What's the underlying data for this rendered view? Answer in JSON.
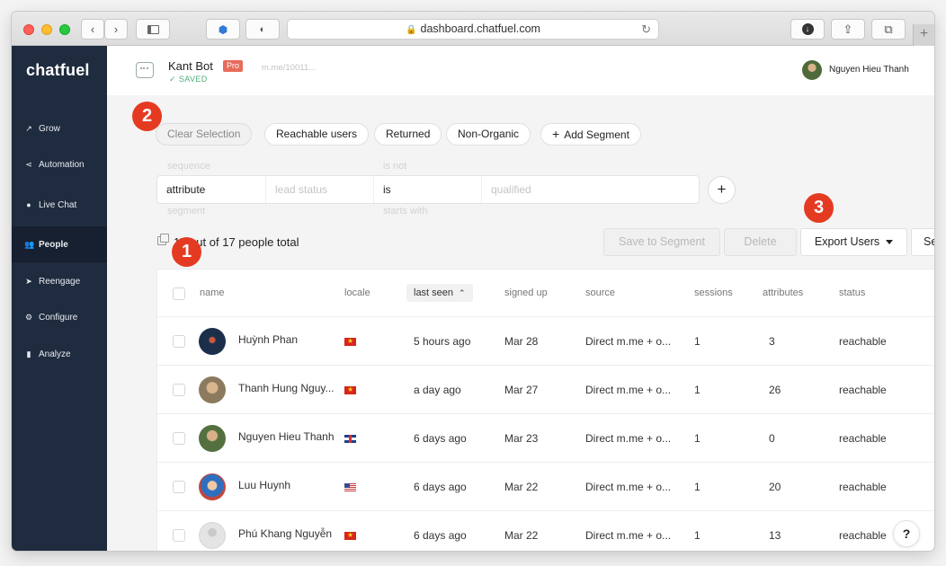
{
  "browser": {
    "url": "dashboard.chatfuel.com",
    "plus_tab": "+"
  },
  "sidebar": {
    "logo": "chatfuel",
    "items": [
      {
        "label": "Grow",
        "icon": "trend-up-icon"
      },
      {
        "label": "Automation",
        "icon": "share-nodes-icon"
      },
      {
        "label": "Live Chat",
        "icon": "chat-bubble-icon"
      },
      {
        "label": "People",
        "icon": "people-icon",
        "active": true
      },
      {
        "label": "Reengage",
        "icon": "paper-plane-icon"
      },
      {
        "label": "Configure",
        "icon": "gear-icon"
      },
      {
        "label": "Analyze",
        "icon": "bar-chart-icon"
      }
    ]
  },
  "header": {
    "bot_name": "Kant Bot",
    "plan_badge": "Pro",
    "saved_status": "SAVED",
    "bot_link": "m.me/10011...",
    "user_name": "Nguyen Hieu Thanh"
  },
  "segments": {
    "clear": "Clear Selection",
    "chips": [
      "Reachable users",
      "Returned",
      "Non-Organic"
    ],
    "add": "Add Segment"
  },
  "filter": {
    "ghost_top": [
      "sequence",
      "is not"
    ],
    "ghost_bottom": [
      "segment",
      "starts with"
    ],
    "type": "attribute",
    "attribute_placeholder": "lead status",
    "operator": "is",
    "value_placeholder": "qualified",
    "add_button": "+"
  },
  "summary": {
    "total_text": "17 out of 17 people total"
  },
  "actions": {
    "save_to_segment": "Save to Segment",
    "delete": "Delete",
    "export_users": "Export Users",
    "truncated_button": "Se"
  },
  "table": {
    "columns": [
      "name",
      "locale",
      "last seen",
      "signed up",
      "source",
      "sessions",
      "attributes",
      "status"
    ],
    "sorted_column": "last seen",
    "rows": [
      {
        "name": "Huỳnh Phan",
        "locale": "vn",
        "last_seen": "5 hours ago",
        "signed_up": "Mar 28",
        "source": "Direct m.me + o...",
        "sessions": "1",
        "attributes": "3",
        "status": "reachable",
        "avatar_color": "#1b2f4a"
      },
      {
        "name": "Thanh Hung Nguy...",
        "locale": "vn",
        "last_seen": "a day ago",
        "signed_up": "Mar 27",
        "source": "Direct m.me + o...",
        "sessions": "1",
        "attributes": "26",
        "status": "reachable",
        "avatar_color": "#8b7a5e"
      },
      {
        "name": "Nguyen Hieu Thanh",
        "locale": "gb",
        "last_seen": "6 days ago",
        "signed_up": "Mar 23",
        "source": "Direct m.me + o...",
        "sessions": "1",
        "attributes": "0",
        "status": "reachable",
        "avatar_color": "#55703f"
      },
      {
        "name": "Luu Huynh",
        "locale": "us",
        "last_seen": "6 days ago",
        "signed_up": "Mar 22",
        "source": "Direct m.me + o...",
        "sessions": "1",
        "attributes": "20",
        "status": "reachable",
        "avatar_color": "#c4463a"
      },
      {
        "name": "Phú Khang Nguyễn",
        "locale": "vn",
        "last_seen": "6 days ago",
        "signed_up": "Mar 22",
        "source": "Direct m.me + o...",
        "sessions": "1",
        "attributes": "13",
        "status": "reachable",
        "avatar_color": "#e4e4e4"
      }
    ]
  },
  "help": "?",
  "annotations": [
    "1",
    "2",
    "3"
  ],
  "colors": {
    "sidebar_bg": "#1f2b3e",
    "badge_red": "#e53a22",
    "pro_badge": "#e76b5a",
    "saved_green": "#4caf7a"
  }
}
